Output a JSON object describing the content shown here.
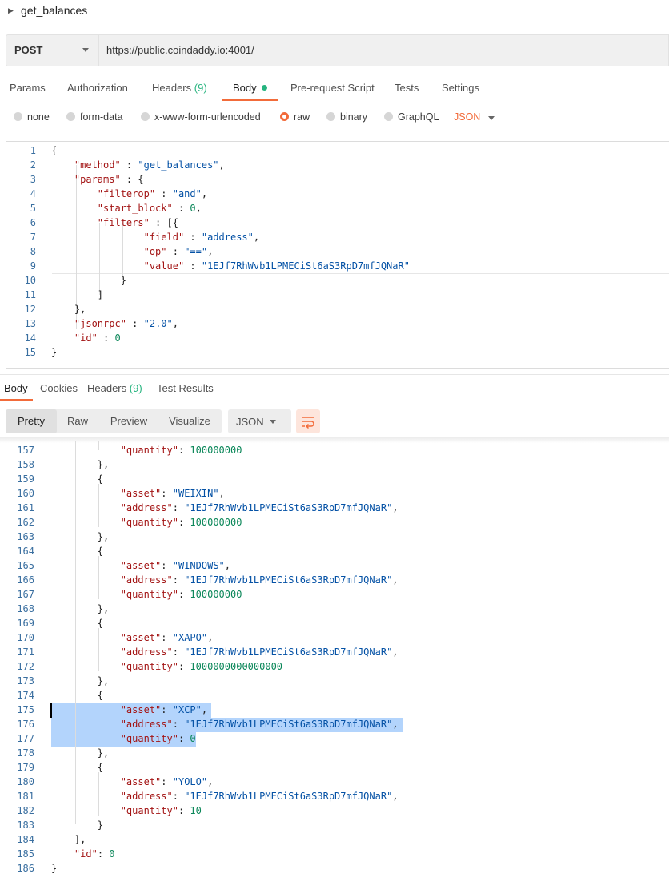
{
  "request": {
    "name": "get_balances",
    "method": "POST",
    "url": "https://public.coindaddy.io:4001/"
  },
  "request_tabs": {
    "params": "Params",
    "authorization": "Authorization",
    "headers": "Headers",
    "headers_count": "(9)",
    "body": "Body",
    "pre_request": "Pre-request Script",
    "tests": "Tests",
    "settings": "Settings"
  },
  "body_types": {
    "none": "none",
    "form_data": "form-data",
    "urlencoded": "x-www-form-urlencoded",
    "raw": "raw",
    "binary": "binary",
    "graphql": "GraphQL",
    "selected": "raw",
    "language": "JSON"
  },
  "request_body": [
    {
      "n": "1",
      "t": "{"
    },
    {
      "n": "2",
      "t": "    \"method\" : \"get_balances\","
    },
    {
      "n": "3",
      "t": "    \"params\" : {"
    },
    {
      "n": "4",
      "t": "        \"filterop\" : \"and\","
    },
    {
      "n": "5",
      "t": "        \"start_block\" : 0,"
    },
    {
      "n": "6",
      "t": "        \"filters\" : [{"
    },
    {
      "n": "7",
      "t": "                \"field\" : \"address\","
    },
    {
      "n": "8",
      "t": "                \"op\" : \"==\","
    },
    {
      "n": "9",
      "t": "                \"value\" : \"1EJf7RhWvb1LPMECiSt6aS3RpD7mfJQNaR\""
    },
    {
      "n": "10",
      "t": "            }"
    },
    {
      "n": "11",
      "t": "        ]"
    },
    {
      "n": "12",
      "t": "    },"
    },
    {
      "n": "13",
      "t": "    \"jsonrpc\" : \"2.0\","
    },
    {
      "n": "14",
      "t": "    \"id\" : 0"
    },
    {
      "n": "15",
      "t": "}"
    }
  ],
  "response_tabs": {
    "body": "Body",
    "cookies": "Cookies",
    "headers": "Headers",
    "headers_count": "(9)",
    "test_results": "Test Results"
  },
  "response_toolbar": {
    "pretty": "Pretty",
    "raw": "Raw",
    "preview": "Preview",
    "visualize": "Visualize",
    "format": "JSON"
  },
  "response_body": [
    {
      "n": "157",
      "t": "            \"quantity\": 100000000"
    },
    {
      "n": "158",
      "t": "        },"
    },
    {
      "n": "159",
      "t": "        {"
    },
    {
      "n": "160",
      "t": "            \"asset\": \"WEIXIN\","
    },
    {
      "n": "161",
      "t": "            \"address\": \"1EJf7RhWvb1LPMECiSt6aS3RpD7mfJQNaR\","
    },
    {
      "n": "162",
      "t": "            \"quantity\": 100000000"
    },
    {
      "n": "163",
      "t": "        },"
    },
    {
      "n": "164",
      "t": "        {"
    },
    {
      "n": "165",
      "t": "            \"asset\": \"WINDOWS\","
    },
    {
      "n": "166",
      "t": "            \"address\": \"1EJf7RhWvb1LPMECiSt6aS3RpD7mfJQNaR\","
    },
    {
      "n": "167",
      "t": "            \"quantity\": 100000000"
    },
    {
      "n": "168",
      "t": "        },"
    },
    {
      "n": "169",
      "t": "        {"
    },
    {
      "n": "170",
      "t": "            \"asset\": \"XAPO\","
    },
    {
      "n": "171",
      "t": "            \"address\": \"1EJf7RhWvb1LPMECiSt6aS3RpD7mfJQNaR\","
    },
    {
      "n": "172",
      "t": "            \"quantity\": 1000000000000000"
    },
    {
      "n": "173",
      "t": "        },"
    },
    {
      "n": "174",
      "t": "        {"
    },
    {
      "n": "175",
      "t": "            \"asset\": \"XCP\","
    },
    {
      "n": "176",
      "t": "            \"address\": \"1EJf7RhWvb1LPMECiSt6aS3RpD7mfJQNaR\","
    },
    {
      "n": "177",
      "t": "            \"quantity\": 0"
    },
    {
      "n": "178",
      "t": "        },"
    },
    {
      "n": "179",
      "t": "        {"
    },
    {
      "n": "180",
      "t": "            \"asset\": \"YOLO\","
    },
    {
      "n": "181",
      "t": "            \"address\": \"1EJf7RhWvb1LPMECiSt6aS3RpD7mfJQNaR\","
    },
    {
      "n": "182",
      "t": "            \"quantity\": 10"
    },
    {
      "n": "183",
      "t": "        }"
    },
    {
      "n": "184",
      "t": "    ],"
    },
    {
      "n": "185",
      "t": "    \"id\": 0"
    },
    {
      "n": "186",
      "t": "}"
    }
  ],
  "colors": {
    "accent": "#f26b3a",
    "success": "#26b47f",
    "json_key": "#a31515",
    "json_string": "#0451a5",
    "json_number": "#098658",
    "selection": "#b3d4fc"
  }
}
